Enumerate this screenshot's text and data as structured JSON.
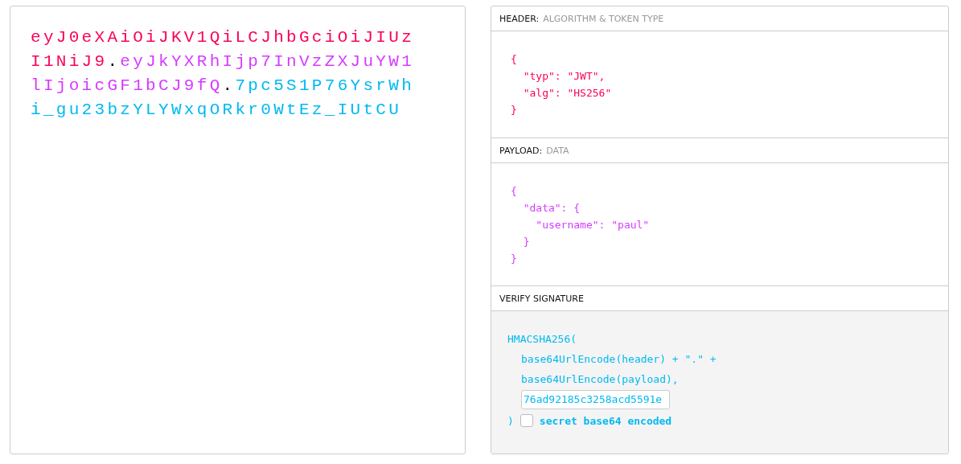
{
  "token": {
    "separator": ".",
    "segments": [
      {
        "text": "eyJ0eXAiOiJKV1QiLCJhbGciOiJIUzI1NiJ9",
        "color": "#fb015b"
      },
      {
        "text": "eyJkYXRhIjp7InVzZXJuYW1lIjoicGF1bCJ9fQ",
        "color": "#d63aff"
      },
      {
        "text": "7pc5S1P76YsrWhi_gu23bzYLYWxqORkr0WtEz_IUtCU",
        "color": "#00b9f1"
      }
    ]
  },
  "header": {
    "label": "HEADER:",
    "sublabel": "ALGORITHM & TOKEN TYPE",
    "code": "{\n  \"typ\": \"JWT\",\n  \"alg\": \"HS256\"\n}"
  },
  "payload": {
    "label": "PAYLOAD:",
    "sublabel": "DATA",
    "code": "{\n  \"data\": {\n    \"username\": \"paul\"\n  }\n}"
  },
  "verify": {
    "label": "VERIFY SIGNATURE",
    "open": "HMACSHA256(",
    "lines": [
      "base64UrlEncode(header) + \".\" +",
      "base64UrlEncode(payload),"
    ],
    "secret": "76ad92185c3258acd5591e",
    "close": ")",
    "checkbox": {
      "label": "secret base64 encoded",
      "checked": false
    }
  }
}
